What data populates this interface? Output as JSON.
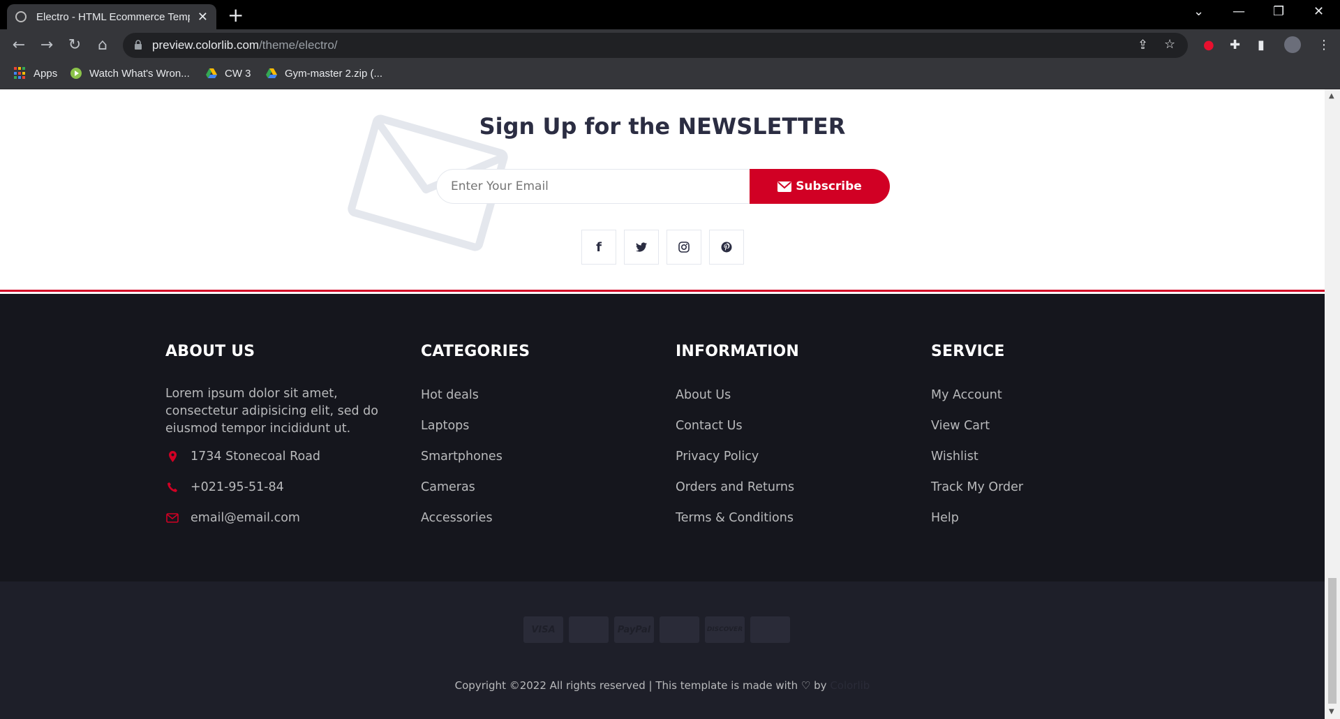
{
  "browser": {
    "tab_title": "Electro - HTML Ecommerce Temp",
    "tab_close": "✕",
    "new_tab": "+",
    "url_host": "preview.colorlib.com",
    "url_path": "/theme/electro/",
    "bookmarks": [
      {
        "label": "Apps"
      },
      {
        "label": "Watch What's Wron..."
      },
      {
        "label": "CW 3"
      },
      {
        "label": "Gym-master 2.zip (..."
      }
    ]
  },
  "newsletter": {
    "title_prefix": "Sign Up for the ",
    "title_strong": "NEWSLETTER",
    "email_placeholder": "Enter Your Email",
    "subscribe_label": "Subscribe",
    "socials": [
      {
        "icon": "facebook-icon",
        "glyph": "f"
      },
      {
        "icon": "twitter-icon",
        "glyph": "t"
      },
      {
        "icon": "instagram-icon",
        "glyph": "◎"
      },
      {
        "icon": "pinterest-icon",
        "glyph": "p"
      }
    ]
  },
  "footer": {
    "about": {
      "title": "ABOUT US",
      "text": "Lorem ipsum dolor sit amet, consectetur adipisicing elit, sed do eiusmod tempor incididunt ut.",
      "address": "1734 Stonecoal Road",
      "phone": "+021-95-51-84",
      "email": "email@email.com"
    },
    "categories": {
      "title": "CATEGORIES",
      "items": [
        "Hot deals",
        "Laptops",
        "Smartphones",
        "Cameras",
        "Accessories"
      ]
    },
    "information": {
      "title": "INFORMATION",
      "items": [
        "About Us",
        "Contact Us",
        "Privacy Policy",
        "Orders and Returns",
        "Terms & Conditions"
      ]
    },
    "service": {
      "title": "SERVICE",
      "items": [
        "My Account",
        "View Cart",
        "Wishlist",
        "Track My Order",
        "Help"
      ]
    },
    "payments": [
      "VISA",
      "",
      "PayPal",
      "",
      "DISCOVER",
      ""
    ],
    "copyright_text": "Copyright ©2022 All rights reserved | This template is made with ",
    "copyright_by": " by ",
    "copyright_brand": "Colorlib",
    "accent_color": "#d10024"
  }
}
